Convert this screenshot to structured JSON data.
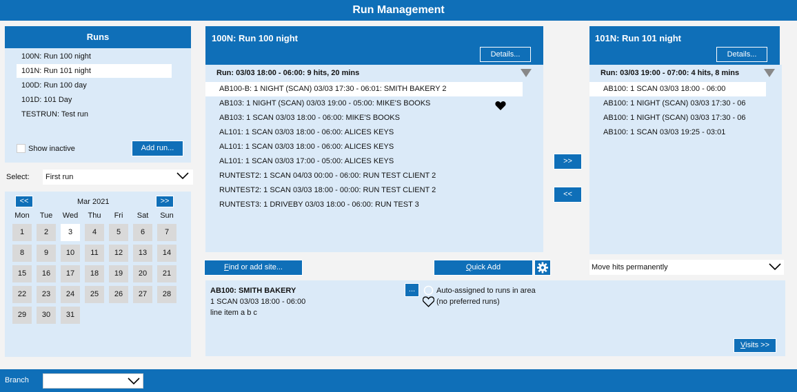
{
  "app": {
    "title": "Run Management"
  },
  "runs_panel": {
    "title": "Runs",
    "items": [
      {
        "label": "100N: Run 100 night"
      },
      {
        "label": "101N: Run 101 night"
      },
      {
        "label": "100D: Run 100 day"
      },
      {
        "label": "101D: 101 Day"
      },
      {
        "label": "TESTRUN: Test run"
      }
    ],
    "selected_index": 1,
    "show_inactive_label": "Show inactive",
    "add_run_label": "Add run..."
  },
  "select": {
    "label": "Select:",
    "value": "First run"
  },
  "calendar": {
    "prev_label": "<<",
    "next_label": ">>",
    "month_label": "Mar 2021",
    "weekdays": [
      "Mon",
      "Tue",
      "Wed",
      "Thu",
      "Fri",
      "Sat",
      "Sun"
    ],
    "days": [
      "1",
      "2",
      "3",
      "4",
      "5",
      "6",
      "7",
      "8",
      "9",
      "10",
      "11",
      "12",
      "13",
      "14",
      "15",
      "16",
      "17",
      "18",
      "19",
      "20",
      "21",
      "22",
      "23",
      "24",
      "25",
      "26",
      "27",
      "28",
      "29",
      "30",
      "31"
    ],
    "today": "3"
  },
  "left_run": {
    "title": "100N: Run 100 night",
    "details_label": "Details...",
    "run_summary": "Run: 03/03 18:00 - 06:00: 9 hits, 20 mins",
    "hits": [
      "AB100-B: 1 NIGHT (SCAN) 03/03 17:30 - 06:01: SMITH BAKERY 2",
      "AB103: 1 NIGHT (SCAN) 03/03 19:00 - 05:00: MIKE'S BOOKS",
      "AB103: 1 SCAN 03/03 18:00 - 06:00: MIKE'S BOOKS",
      "AL101: 1 SCAN 03/03 18:00 - 06:00: ALICES KEYS",
      "AL101: 1 SCAN 03/03 18:00 - 06:00: ALICES KEYS",
      "AL101: 1 SCAN 03/03 17:00 - 05:00: ALICES KEYS",
      "RUNTEST2: 1 SCAN 04/03 00:00 - 06:00: RUN TEST CLIENT 2",
      "RUNTEST2: 1 SCAN 03/03 18:00 - 00:00: RUN TEST CLIENT 2",
      "RUNTEST3: 1 DRIVEBY 03/03 18:00 - 06:00: RUN TEST 3"
    ],
    "selected_index": 0
  },
  "transfer": {
    "right_label": ">>",
    "left_label": "<<"
  },
  "right_run": {
    "title": "101N: Run 101 night",
    "details_label": "Details...",
    "run_summary": "Run: 03/03 19:00 - 07:00: 4 hits, 8 mins",
    "hits": [
      "AB100: 1 SCAN 03/03 18:00 - 06:00",
      "AB100: 1 NIGHT (SCAN) 03/03 17:30 - 06",
      "AB100: 1 NIGHT (SCAN) 03/03 17:30 - 06",
      "AB100: 1 SCAN 03/03 19:25 - 03:01"
    ],
    "selected_index": 0
  },
  "actions": {
    "find_site_label": "Find or add site...",
    "quick_add_label": "Quick Add",
    "move_hits_value": "Move hits permanently"
  },
  "detail": {
    "site_title": "AB100: SMITH BAKERY",
    "line1": "1 SCAN 03/03 18:00 - 06:00",
    "line2": "line item a b c",
    "more_label": "...",
    "auto_assigned": "Auto-assigned to runs in area",
    "preferred": "(no preferred runs)",
    "visits_label": "Visits >>"
  },
  "footer": {
    "branch_label": "Branch",
    "branch_value": ""
  }
}
